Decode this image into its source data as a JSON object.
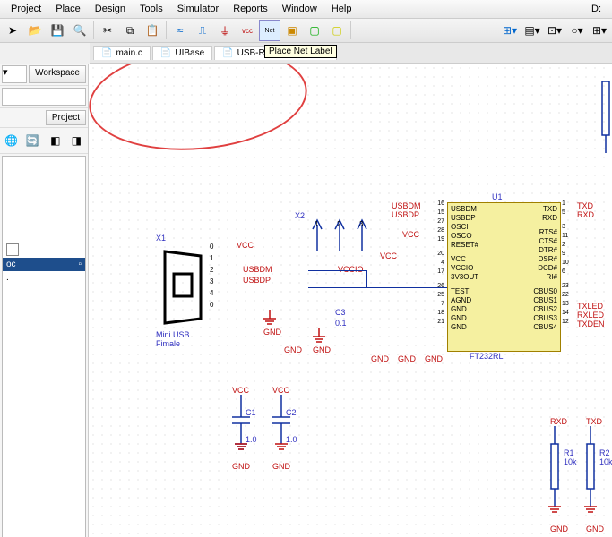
{
  "menu": [
    "Project",
    "Place",
    "Design",
    "Tools",
    "Simulator",
    "Reports",
    "Window",
    "Help"
  ],
  "titleRight": "D:",
  "tabs": [
    {
      "icon": "c",
      "label": "main.c"
    },
    {
      "icon": "sch",
      "label": "UIBase"
    },
    {
      "icon": "sch",
      "label": "USB-RS485v2.SchDoc"
    }
  ],
  "tooltip": "Place Net Label",
  "panel": {
    "workspace": "Workspace",
    "project": "Project"
  },
  "tree": {
    "item1": "oc",
    "item2": "."
  },
  "schematic": {
    "x1": {
      "ref": "X1",
      "desc": "Mini USB Fimale",
      "pins": [
        "0",
        "1",
        "2",
        "3",
        "4",
        "0"
      ],
      "nets": [
        "VCC",
        "",
        "USBDM",
        "USBDP",
        "",
        ""
      ],
      "gnd": "GND"
    },
    "x2": {
      "ref": "X2",
      "pins": [
        "1",
        "2",
        "3"
      ],
      "vcc": "VCC",
      "vccio": "VCCIO",
      "gnd": "GND"
    },
    "c3": {
      "ref": "C3",
      "val": "0.1",
      "gnd": "GND"
    },
    "c1": {
      "ref": "C1",
      "val": "1.0",
      "vcc": "VCC",
      "gnd": "GND"
    },
    "c2": {
      "ref": "C2",
      "val": "1.0",
      "vcc": "VCC",
      "gnd": "GND"
    },
    "u1": {
      "ref": "U1",
      "type": "FT232RL",
      "left_nets": [
        "USBDM",
        "USBDP",
        "",
        "VCC"
      ],
      "left_pins": [
        {
          "n": "16",
          "name": "USBDM"
        },
        {
          "n": "15",
          "name": "USBDP"
        },
        {
          "n": "27",
          "name": "OSCI"
        },
        {
          "n": "28",
          "name": "OSCO"
        },
        {
          "n": "19",
          "name": "RESET#"
        },
        {
          "n": "20",
          "name": "VCC"
        },
        {
          "n": "4",
          "name": "VCCIO"
        },
        {
          "n": "17",
          "name": "3V3OUT"
        },
        {
          "n": "26",
          "name": "TEST"
        },
        {
          "n": "25",
          "name": "AGND"
        },
        {
          "n": "7",
          "name": "GND"
        },
        {
          "n": "18",
          "name": "GND"
        },
        {
          "n": "21",
          "name": "GND"
        }
      ],
      "right_pins": [
        {
          "n": "1",
          "name": "TXD",
          "net": "TXD"
        },
        {
          "n": "5",
          "name": "RXD",
          "net": "RXD"
        },
        {
          "n": "3",
          "name": "RTS#"
        },
        {
          "n": "11",
          "name": "CTS#"
        },
        {
          "n": "2",
          "name": "DTR#"
        },
        {
          "n": "9",
          "name": "DSR#"
        },
        {
          "n": "10",
          "name": "DCD#"
        },
        {
          "n": "6",
          "name": "RI#"
        },
        {
          "n": "23",
          "name": "CBUS0",
          "net": "TXLED"
        },
        {
          "n": "22",
          "name": "CBUS1",
          "net": "RXLED"
        },
        {
          "n": "13",
          "name": "CBUS2",
          "net": "TXDEN"
        },
        {
          "n": "14",
          "name": "CBUS3"
        },
        {
          "n": "12",
          "name": "CBUS4"
        }
      ],
      "gnd": "GND"
    },
    "r1": {
      "ref": "R1",
      "val": "10k",
      "net": "RXD",
      "gnd": "GND"
    },
    "r2": {
      "ref": "R2",
      "val": "10k",
      "net": "TXD",
      "gnd": "GND"
    }
  }
}
